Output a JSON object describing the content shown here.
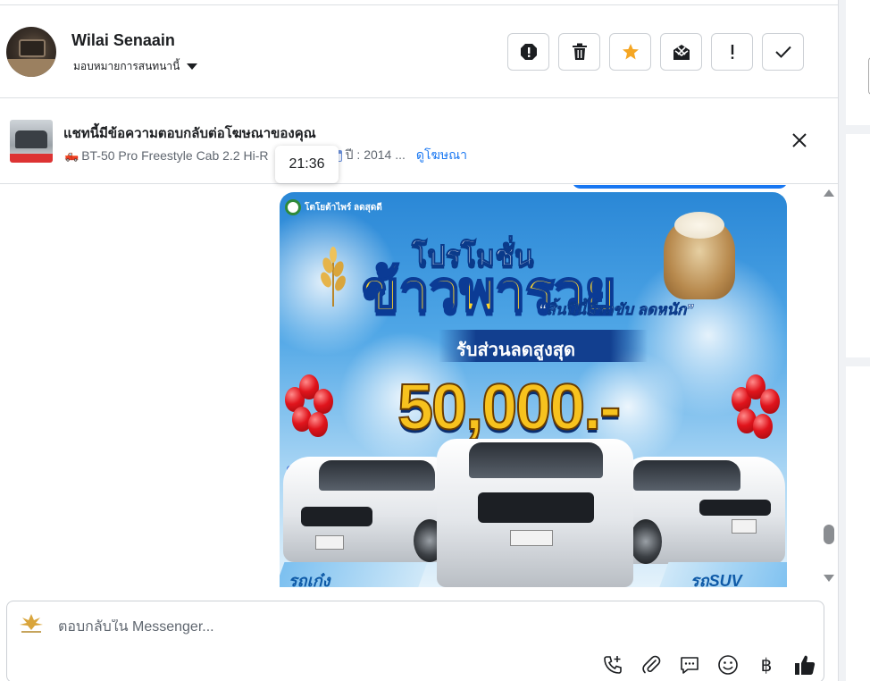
{
  "header": {
    "user_name": "Wilai Senaain",
    "assign_label": "มอบหมายการสนทนานี้",
    "toolbar": [
      {
        "name": "spam",
        "icon": "alert-octagon-icon"
      },
      {
        "name": "delete",
        "icon": "trash-icon"
      },
      {
        "name": "star",
        "icon": "star-icon"
      },
      {
        "name": "mark-unread",
        "icon": "envelope-x-icon"
      },
      {
        "name": "important",
        "icon": "exclamation-icon"
      },
      {
        "name": "done",
        "icon": "check-icon"
      }
    ],
    "star_color": "#f5a623"
  },
  "ad_bar": {
    "title": "แชทนี้มีข้อความตอบกลับต่อโฆษณาของคุณ",
    "vehicle": "BT-50 Pro Freestyle Cab 2.2 Hi-R",
    "year_prefix": "2014",
    "year_text": "ปี : 2014 ...",
    "link": "ดูโฆษณา",
    "link_color": "#1877f2"
  },
  "tooltip": {
    "time": "21:36"
  },
  "promo": {
    "brand": "โตโยต้าไพร์ ลดสุดดี",
    "line1": "โปรโมชั่น",
    "line2": "ข้าวพารวย",
    "tagline": "“สิ้นปีนี้มีรถขับ ลดหนัก”",
    "discount_label": "รับส่วนลดสูงสุด",
    "amount": "50,000.-",
    "label_left": "รถเก๋ง",
    "label_right": "รถSUV"
  },
  "composer": {
    "placeholder": "ตอบกลับใน Messenger...",
    "icons": [
      "phone-plus-icon",
      "paperclip-icon",
      "saved-reply-icon",
      "emoji-icon",
      "baht-icon",
      "thumbs-up-icon"
    ],
    "baht_symbol": "฿"
  }
}
